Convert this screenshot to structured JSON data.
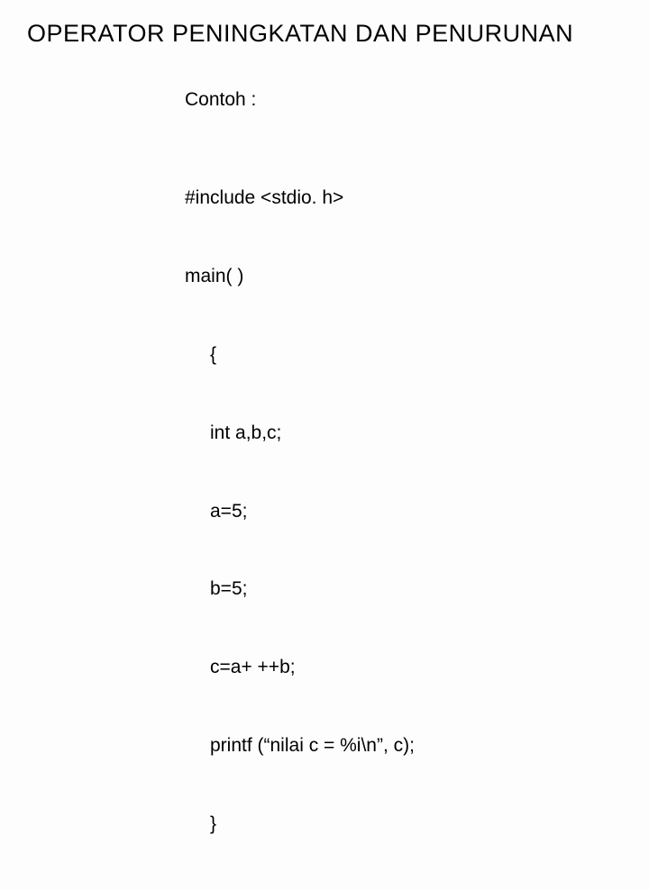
{
  "title": "OPERATOR PENINGKATAN DAN PENURUNAN",
  "contoh_label": "Contoh :",
  "code": {
    "l1": "#include <stdio. h>",
    "l2": "main( )",
    "l3": "{",
    "l4": "int a,b,c;",
    "l5": "a=5;",
    "l6": "b=5;",
    "l7": "c=a+ ++b;",
    "l8": "printf (“nilai c = %i\\n”, c);",
    "l9": "}"
  }
}
